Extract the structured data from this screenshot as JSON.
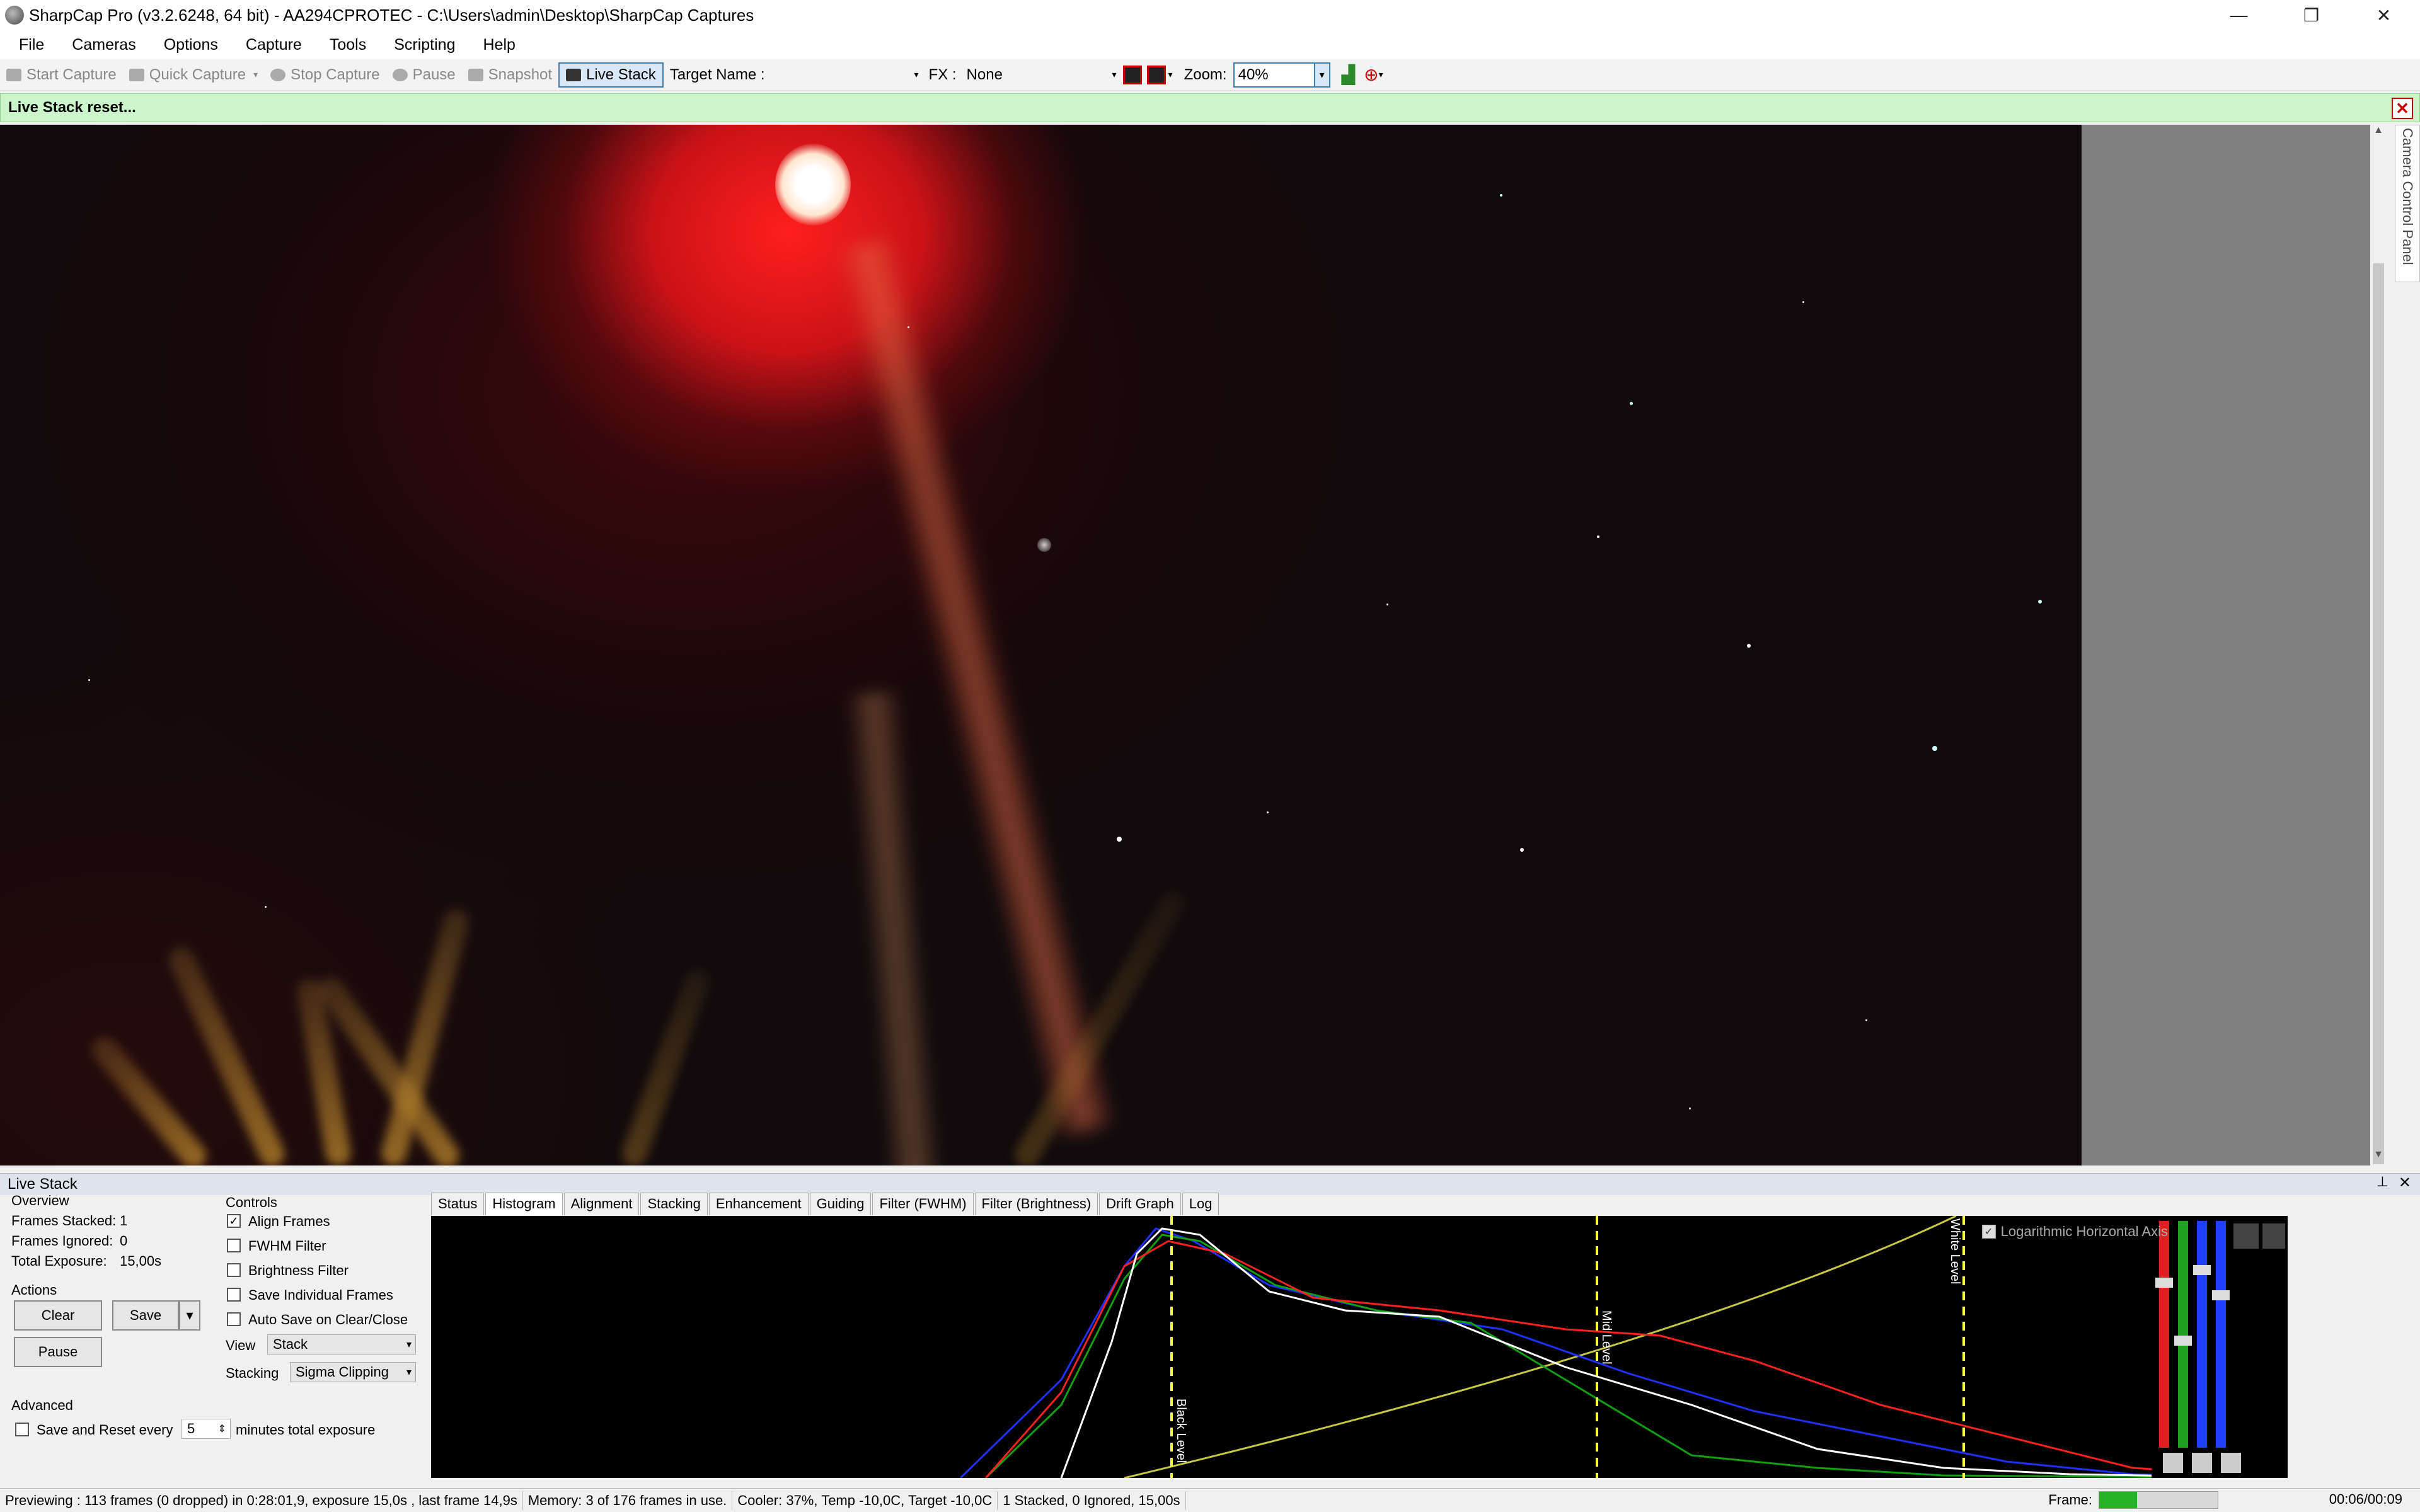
{
  "window": {
    "title": "SharpCap Pro (v3.2.6248, 64 bit) - AA294CPROTEC - C:\\Users\\admin\\Desktop\\SharpCap Captures",
    "minimize": "—",
    "restore": "❐",
    "close": "✕"
  },
  "menu": [
    "File",
    "Cameras",
    "Options",
    "Capture",
    "Tools",
    "Scripting",
    "Help"
  ],
  "toolbar": {
    "start_capture": "Start Capture",
    "quick_capture": "Quick Capture",
    "stop_capture": "Stop Capture",
    "pause": "Pause",
    "snapshot": "Snapshot",
    "live_stack": "Live Stack",
    "target_name_label": "Target Name :",
    "target_name_value": "",
    "fx_label": "FX :",
    "fx_value": "None",
    "zoom_label": "Zoom:",
    "zoom_value": "40%"
  },
  "notification": {
    "text": "Live Stack reset...",
    "close": "✕"
  },
  "side_tab": "Camera Control Panel",
  "live_stack": {
    "title": "Live Stack",
    "overview_label": "Overview",
    "frames_stacked_label": "Frames Stacked:",
    "frames_stacked_value": "1",
    "frames_ignored_label": "Frames Ignored:",
    "frames_ignored_value": "0",
    "total_exposure_label": "Total Exposure:",
    "total_exposure_value": "15,00s",
    "actions_label": "Actions",
    "clear": "Clear",
    "save": "Save",
    "pause": "Pause",
    "advanced_label": "Advanced",
    "save_reset_label": "Save and Reset every",
    "save_reset_value": "5",
    "save_reset_unit": "minutes total exposure",
    "controls_label": "Controls",
    "align_frames": "Align Frames",
    "fwhm_filter": "FWHM Filter",
    "brightness_filter": "Brightness Filter",
    "save_individual": "Save Individual Frames",
    "auto_save": "Auto Save on Clear/Close",
    "view_label": "View",
    "view_value": "Stack",
    "stacking_label": "Stacking",
    "stacking_value": "Sigma Clipping",
    "tabs": [
      "Status",
      "Histogram",
      "Alignment",
      "Stacking",
      "Enhancement",
      "Guiding",
      "Filter (FWHM)",
      "Filter (Brightness)",
      "Drift Graph",
      "Log"
    ],
    "active_tab": "Histogram",
    "log_axis_label": "Logarithmic Horizontal Axis",
    "black_level": "Black Level",
    "mid_level": "Mid Level",
    "white_level": "White Level"
  },
  "status": {
    "previewing": "Previewing : 113 frames (0 dropped) in 0:28:01,9, exposure 15,0s , last frame 14,9s",
    "memory": "Memory: 3 of 176 frames in use.",
    "cooler": "Cooler: 37%, Temp -10,0C, Target -10,0C",
    "stacked": "1 Stacked, 0 Ignored, 15,00s",
    "frame_label": "Frame:",
    "frame_progress": 0.32,
    "time": "00:06/00:09"
  },
  "colors": {
    "accent": "#3c7fb1",
    "notify_bg": "#ccf5cc",
    "histo_red": "#ff2020",
    "histo_green": "#10a010",
    "histo_blue": "#2030ff",
    "level_line": "#ffff40"
  }
}
